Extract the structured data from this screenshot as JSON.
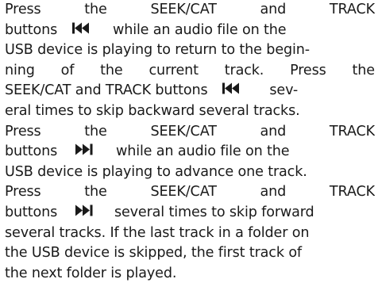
{
  "paragraph": {
    "line1": [
      "Press",
      "the",
      "SEEK/CAT",
      "and",
      "TRACK"
    ],
    "line2_pre": "buttons",
    "line2_post": "while an audio file on the",
    "line3": "USB device is playing to return to the begin-",
    "line4": [
      "ning",
      "of",
      "the",
      "current",
      "track.",
      "Press",
      "the"
    ],
    "line5_pre": "SEEK/CAT and TRACK buttons",
    "line5_post": "sev-",
    "line6": "eral times to skip backward several tracks.",
    "line7": [
      "Press",
      "the",
      "SEEK/CAT",
      "and",
      "TRACK"
    ],
    "line8_pre": "buttons",
    "line8_post": "while an audio file on the",
    "line9": "USB device is playing to advance one track.",
    "line10": [
      "Press",
      "the",
      "SEEK/CAT",
      "and",
      "TRACK"
    ],
    "line11_pre": "buttons",
    "line11_post": "several times to skip forward",
    "line12": "several tracks. If the last track in a folder on",
    "line13": "the USB device is skipped, the first track of",
    "line14": "the next folder is played."
  },
  "icons": {
    "seek_back": "seek-back-icon",
    "seek_forward": "seek-forward-icon"
  },
  "colors": {
    "text": "#1a1a1a"
  }
}
